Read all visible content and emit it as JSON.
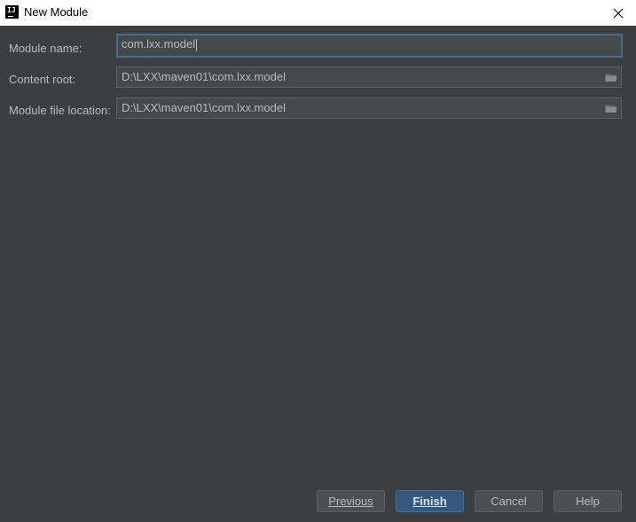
{
  "window": {
    "title": "New Module",
    "logo_text": "IJ"
  },
  "form": {
    "module_name": {
      "label": "Module name:",
      "value": "com.lxx.model"
    },
    "content_root": {
      "label": "Content root:",
      "value": "D:\\LXX\\maven01\\com.lxx.model"
    },
    "module_file_location": {
      "label": "Module file location:",
      "value": "D:\\LXX\\maven01\\com.lxx.model"
    }
  },
  "buttons": {
    "previous": "Previous",
    "finish": "Finish",
    "cancel": "Cancel",
    "help": "Help"
  },
  "icons": {
    "close": "close-icon",
    "browse": "folder-icon",
    "logo": "intellij-logo-icon"
  },
  "colors": {
    "background": "#3c3f41",
    "field_background": "#45494a",
    "focus_border": "#466d94",
    "default_button": "#365880",
    "text": "#bbbbbb"
  }
}
